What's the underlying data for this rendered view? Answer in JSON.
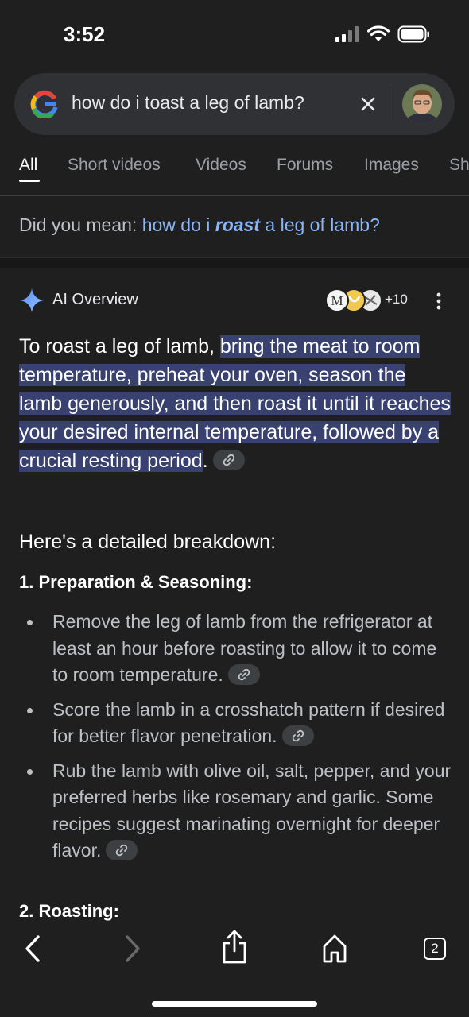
{
  "status_bar": {
    "time": "3:52"
  },
  "search": {
    "query": "how do i toast a leg of lamb?"
  },
  "tabs": [
    {
      "label": "All",
      "active": true
    },
    {
      "label": "Short videos"
    },
    {
      "label": "Videos"
    },
    {
      "label": "Forums"
    },
    {
      "label": "Images"
    },
    {
      "label": "Sh"
    }
  ],
  "did_you_mean": {
    "prefix": "Did you mean: ",
    "link_before": "how do i ",
    "link_bold": "roast",
    "link_after": " a leg of lamb?"
  },
  "ai_overview": {
    "title": "AI Overview",
    "source_count": "+10",
    "summary_plain": "To roast a leg of lamb, ",
    "summary_highlight": "bring the meat to room temperature, preheat your oven, season the lamb generously, and then roast it until it reaches your desired internal temperature, followed by a crucial resting period",
    "summary_end": ".",
    "breakdown_heading": "Here's a detailed breakdown:",
    "sections": [
      {
        "heading": "1. Preparation & Seasoning:",
        "bullets": [
          "Remove the leg of lamb from the refrigerator at least an hour before roasting to allow it to come to room temperature.",
          "Score the lamb in a crosshatch pattern if desired for better flavor penetration.",
          "Rub the lamb with olive oil, salt, pepper, and your preferred herbs like rosemary and garlic. Some recipes suggest marinating overnight for deeper flavor."
        ]
      },
      {
        "heading": "2. Roasting:"
      }
    ]
  },
  "bottom_nav": {
    "tab_count": "2"
  },
  "colors": {
    "background": "#1f1f1f",
    "link": "#8ab4f8",
    "highlight": "#394170",
    "chip": "#3c4043"
  }
}
